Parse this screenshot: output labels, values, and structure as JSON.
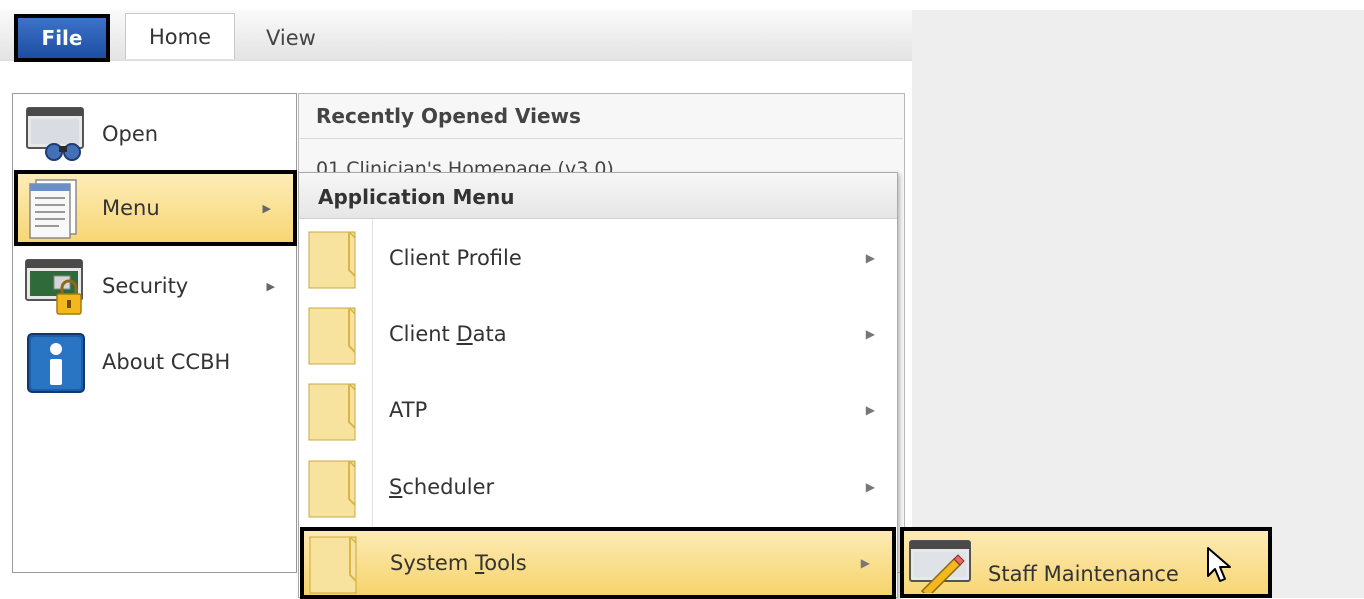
{
  "ribbon": {
    "tabs": [
      {
        "label": "File"
      },
      {
        "label": "Home"
      },
      {
        "label": "View"
      }
    ]
  },
  "file_menu": {
    "items": [
      {
        "label": "Open",
        "icon": "open-binoculars-icon"
      },
      {
        "label": "Menu",
        "icon": "document-list-icon"
      },
      {
        "label": "Security",
        "icon": "security-lock-icon"
      },
      {
        "label": "About CCBH",
        "icon": "info-icon"
      }
    ]
  },
  "recent": {
    "title": "Recently Opened Views",
    "items": [
      "01 Clinician's Homepage (v3.0)"
    ]
  },
  "application_menu": {
    "title": "Application Menu",
    "items": [
      {
        "label_before": "Client Profile",
        "underline": "",
        "label_after": ""
      },
      {
        "label_before": "Client ",
        "underline": "D",
        "label_after": "ata"
      },
      {
        "label_before": "ATP",
        "underline": "",
        "label_after": ""
      },
      {
        "label_before": "",
        "underline": "S",
        "label_after": "cheduler"
      },
      {
        "label_before": "System ",
        "underline": "T",
        "label_after": "ools"
      }
    ]
  },
  "submenu": {
    "items": [
      {
        "label": "Staff Maintenance",
        "icon": "staff-maintenance-icon"
      }
    ]
  },
  "colors": {
    "file_tab": "#1d4ea3",
    "highlight": "#f7d674",
    "selection_border": "#000000"
  }
}
